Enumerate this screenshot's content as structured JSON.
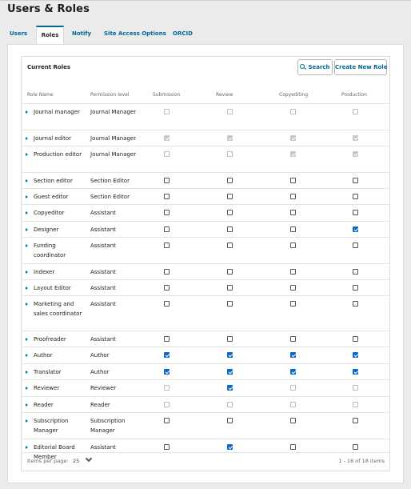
{
  "page": {
    "title": "Users & Roles"
  },
  "tabs": [
    "Users",
    "Roles",
    "Notify",
    "Site Access Options",
    "ORCID"
  ],
  "active_tab": "Roles",
  "grid": {
    "title": "Current Roles",
    "search_label": "Search",
    "create_label": "Create New Role",
    "columns": [
      "Role Name",
      "Permission level",
      "Submission",
      "Review",
      "Copyediting",
      "Production"
    ]
  },
  "roles": [
    {
      "name": "Journal manager",
      "perm": "Journal Manager",
      "sub": [
        0,
        1
      ],
      "rev": [
        0,
        1
      ],
      "copy": [
        0,
        1
      ],
      "prod": [
        0,
        1
      ]
    },
    {
      "name": "Journal editor",
      "perm": "Journal Manager",
      "sub": [
        1,
        1
      ],
      "rev": [
        1,
        1
      ],
      "copy": [
        1,
        1
      ],
      "prod": [
        1,
        1
      ]
    },
    {
      "name": "Production editor",
      "perm": "Journal Manager",
      "sub": [
        0,
        1
      ],
      "rev": [
        0,
        1
      ],
      "copy": [
        1,
        1
      ],
      "prod": [
        1,
        1
      ]
    },
    {
      "name": "Section editor",
      "perm": "Section Editor",
      "sub": [
        0,
        0
      ],
      "rev": [
        0,
        0
      ],
      "copy": [
        0,
        0
      ],
      "prod": [
        0,
        0
      ]
    },
    {
      "name": "Guest editor",
      "perm": "Section Editor",
      "sub": [
        0,
        0
      ],
      "rev": [
        0,
        0
      ],
      "copy": [
        0,
        0
      ],
      "prod": [
        0,
        0
      ]
    },
    {
      "name": "Copyeditor",
      "perm": "Assistant",
      "sub": [
        0,
        0
      ],
      "rev": [
        0,
        0
      ],
      "copy": [
        0,
        0
      ],
      "prod": [
        0,
        0
      ]
    },
    {
      "name": "Designer",
      "perm": "Assistant",
      "sub": [
        0,
        0
      ],
      "rev": [
        0,
        0
      ],
      "copy": [
        0,
        0
      ],
      "prod": [
        1,
        0
      ]
    },
    {
      "name": "Funding coordinator",
      "perm": "Assistant",
      "sub": [
        0,
        0
      ],
      "rev": [
        0,
        0
      ],
      "copy": [
        0,
        0
      ],
      "prod": [
        0,
        0
      ]
    },
    {
      "name": "Indexer",
      "perm": "Assistant",
      "sub": [
        0,
        0
      ],
      "rev": [
        0,
        0
      ],
      "copy": [
        0,
        0
      ],
      "prod": [
        0,
        0
      ]
    },
    {
      "name": "Layout Editor",
      "perm": "Assistant",
      "sub": [
        0,
        0
      ],
      "rev": [
        0,
        0
      ],
      "copy": [
        0,
        0
      ],
      "prod": [
        0,
        0
      ]
    },
    {
      "name": "Marketing and sales coordinator",
      "perm": "Assistant",
      "sub": [
        0,
        0
      ],
      "rev": [
        0,
        0
      ],
      "copy": [
        0,
        0
      ],
      "prod": [
        0,
        0
      ]
    },
    {
      "name": "Proofreader",
      "perm": "Assistant",
      "sub": [
        0,
        0
      ],
      "rev": [
        0,
        0
      ],
      "copy": [
        0,
        0
      ],
      "prod": [
        0,
        0
      ]
    },
    {
      "name": "Author",
      "perm": "Author",
      "sub": [
        1,
        0
      ],
      "rev": [
        1,
        0
      ],
      "copy": [
        1,
        0
      ],
      "prod": [
        1,
        0
      ]
    },
    {
      "name": "Translator",
      "perm": "Author",
      "sub": [
        1,
        0
      ],
      "rev": [
        1,
        0
      ],
      "copy": [
        1,
        0
      ],
      "prod": [
        1,
        0
      ]
    },
    {
      "name": "Reviewer",
      "perm": "Reviewer",
      "sub": [
        0,
        1
      ],
      "rev": [
        1,
        0
      ],
      "copy": [
        0,
        1
      ],
      "prod": [
        0,
        1
      ]
    },
    {
      "name": "Reader",
      "perm": "Reader",
      "sub": [
        0,
        1
      ],
      "rev": [
        0,
        1
      ],
      "copy": [
        0,
        1
      ],
      "prod": [
        0,
        1
      ]
    },
    {
      "name": "Subscription Manager",
      "perm": "Subscription Manager",
      "sub": [
        0,
        0
      ],
      "rev": [
        0,
        0
      ],
      "copy": [
        0,
        0
      ],
      "prod": [
        0,
        0
      ]
    },
    {
      "name": "Editorial Board Member",
      "perm": "Assistant",
      "sub": [
        0,
        0
      ],
      "rev": [
        1,
        0
      ],
      "copy": [
        0,
        0
      ],
      "prod": [
        0,
        0
      ]
    }
  ],
  "footer": {
    "items_per_page_label": "Items per page:",
    "items_per_page_value": "25",
    "count_text": "1 - 18 of 18 items"
  },
  "colors": {
    "accent": "#006798",
    "checked": "#0b69c8",
    "checked_disabled": "#c7c7c7"
  }
}
